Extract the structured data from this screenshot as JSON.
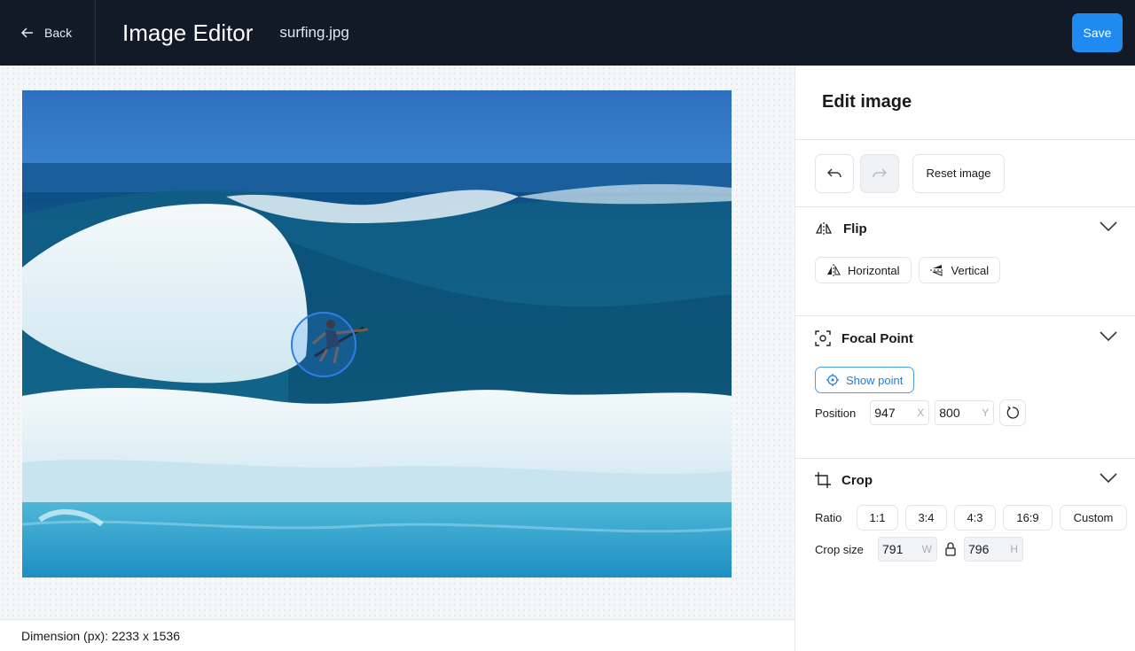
{
  "header": {
    "back_label": "Back",
    "app_title": "Image Editor",
    "file_name": "surfing.jpg",
    "save_label": "Save"
  },
  "canvas": {
    "image_description_icon": "surfing-photo",
    "dimension_text": "Dimension (px): 2233 x 1536"
  },
  "panel": {
    "title": "Edit image",
    "history": {
      "undo_icon": "undo-icon",
      "redo_icon": "redo-icon",
      "reset_label": "Reset image"
    },
    "flip": {
      "title": "Flip",
      "horizontal_label": "Horizontal",
      "vertical_label": "Vertical"
    },
    "focal_point": {
      "title": "Focal Point",
      "show_point_label": "Show point",
      "position_label": "Position",
      "x_value": "947",
      "x_suffix": "X",
      "y_value": "800",
      "y_suffix": "Y"
    },
    "crop": {
      "title": "Crop",
      "ratio_label": "Ratio",
      "ratios": [
        "1:1",
        "3:4",
        "4:3",
        "16:9",
        "Custom"
      ],
      "crop_size_label": "Crop size",
      "width_value": "791",
      "width_suffix": "W",
      "height_value": "796",
      "height_suffix": "H"
    }
  },
  "colors": {
    "topbar": "#111a26",
    "accent": "#1f8bf0",
    "focal": "#2f7fe8"
  }
}
